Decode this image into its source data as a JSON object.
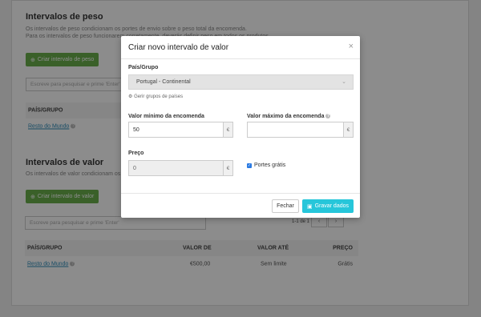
{
  "weight": {
    "title": "Intervalos de peso",
    "desc1": "Os intervalos de peso condicionam os portes de envio sobre o peso total da encomenda.",
    "desc2": "Para os intervalos de peso funcionarem corretamente, deverás definir peso em todos os produtos.",
    "create_label": "Criar intervalo de peso",
    "search_placeholder": "Escreve para pesquisar e prime 'Enter'",
    "col_country": "PAÍS/GRUPO",
    "row_country": "Resto do Mundo"
  },
  "value": {
    "title": "Intervalos de valor",
    "desc": "Os intervalos de valor condicionam os portes de envio sobre o valor total da encomenda.",
    "create_label": "Criar intervalo de valor",
    "search_placeholder": "Escreve para pesquisar e prime 'Enter'",
    "pager": "1-1 de 1",
    "prev": "‹",
    "next": "›",
    "columns": [
      "PAÍS/GRUPO",
      "VALOR DE",
      "VALOR ATÉ",
      "PREÇO"
    ],
    "row": {
      "country": "Resto do Mundo",
      "from": "€500,00",
      "to": "Sem limite",
      "price": "Grátis"
    }
  },
  "modal": {
    "title": "Criar novo intervalo de valor",
    "close": "×",
    "country_label": "País/Grupo",
    "country_value": "Portugal - Continental",
    "manage_groups": "Gerir grupos de países",
    "min_label": "Valor mínimo da encomenda",
    "min_value": "50",
    "max_label": "Valor máximo da encomenda",
    "max_value": "",
    "currency": "€",
    "price_label": "Preço",
    "price_value": "0",
    "free_shipping_label": "Portes grátis",
    "free_shipping_checked": true,
    "btn_close": "Fechar",
    "btn_save": "Gravar dados"
  },
  "colors": {
    "accent_green": "#6ab04c",
    "save_cyan": "#26c6da",
    "link_blue": "#2a8ab8"
  }
}
